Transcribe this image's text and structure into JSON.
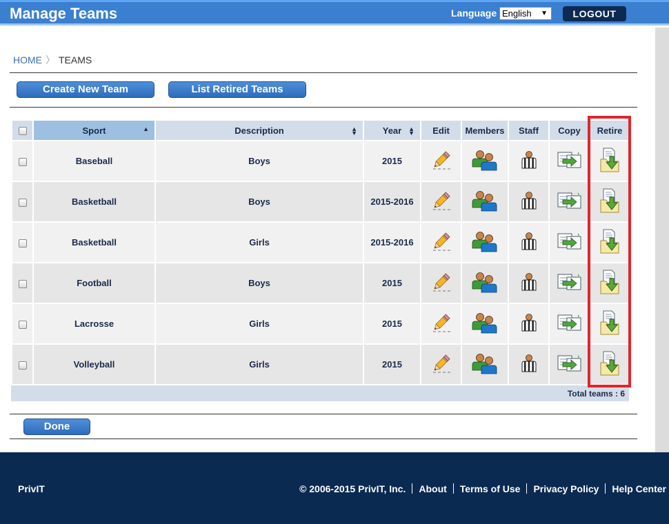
{
  "header": {
    "title": "Manage Teams",
    "language_label": "Language",
    "language_value": "English",
    "logout_label": "LOGOUT"
  },
  "breadcrumb": {
    "home": "HOME",
    "current": "TEAMS"
  },
  "actions": {
    "create_label": "Create New Team",
    "retired_label": "List Retired Teams",
    "done_label": "Done"
  },
  "table": {
    "columns": {
      "sport": "Sport",
      "description": "Description",
      "year": "Year",
      "edit": "Edit",
      "members": "Members",
      "staff": "Staff",
      "copy": "Copy",
      "retire": "Retire"
    },
    "rows": [
      {
        "sport": "Baseball",
        "description": "Boys",
        "year": "2015"
      },
      {
        "sport": "Basketball",
        "description": "Boys",
        "year": "2015-2016"
      },
      {
        "sport": "Basketball",
        "description": "Girls",
        "year": "2015-2016"
      },
      {
        "sport": "Football",
        "description": "Boys",
        "year": "2015"
      },
      {
        "sport": "Lacrosse",
        "description": "Girls",
        "year": "2015"
      },
      {
        "sport": "Volleyball",
        "description": "Girls",
        "year": "2015"
      }
    ],
    "total_text": "Total teams : 6"
  },
  "footer": {
    "brand": "PrivIT",
    "copyright": "© 2006-2015 PrivIT, Inc.",
    "links": [
      "About",
      "Terms of Use",
      "Privacy Policy",
      "Help Center"
    ]
  },
  "icons": {
    "edit": "pencil-icon",
    "members": "people-icon",
    "staff": "referee-icon",
    "copy": "copy-icon",
    "retire": "archive-icon",
    "sort": "sort-arrows-icon"
  },
  "colors": {
    "header": "#3a7fd0",
    "footer": "#0b2a52",
    "highlight": "#e0252b",
    "table_header": "#d3dde9"
  }
}
